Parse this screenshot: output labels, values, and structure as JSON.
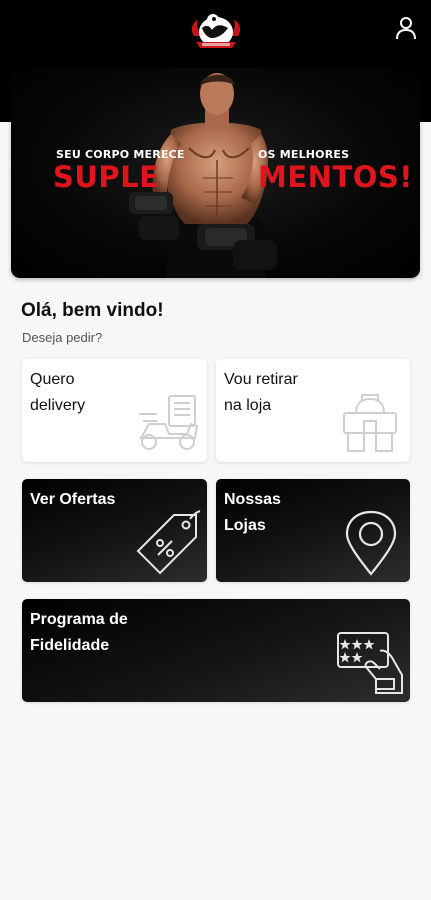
{
  "header": {
    "logo_icon": "bodybuilder-mascot-logo",
    "profile_icon": "user-icon"
  },
  "banner": {
    "left_small": "SEU CORPO MERECE",
    "right_small": "OS MELHORES",
    "left_big": "SUPLE",
    "right_big": "MENTOS!",
    "accent_color": "#e0141c"
  },
  "welcome": {
    "greeting": "Olá, bem vindo!",
    "subtitle": "Deseja pedir?"
  },
  "cards": {
    "delivery": {
      "label": "Quero\ndelivery",
      "icon": "delivery-scooter-icon"
    },
    "pickup": {
      "label": "Vou retirar\nna loja",
      "icon": "store-icon"
    },
    "offers": {
      "label": "Ver Ofertas",
      "icon": "discount-tag-icon"
    },
    "stores": {
      "label": "Nossas\nLojas",
      "icon": "map-pin-icon"
    },
    "loyalty": {
      "label": "Programa de\nFidelidade",
      "icon": "loyalty-card-icon"
    }
  }
}
